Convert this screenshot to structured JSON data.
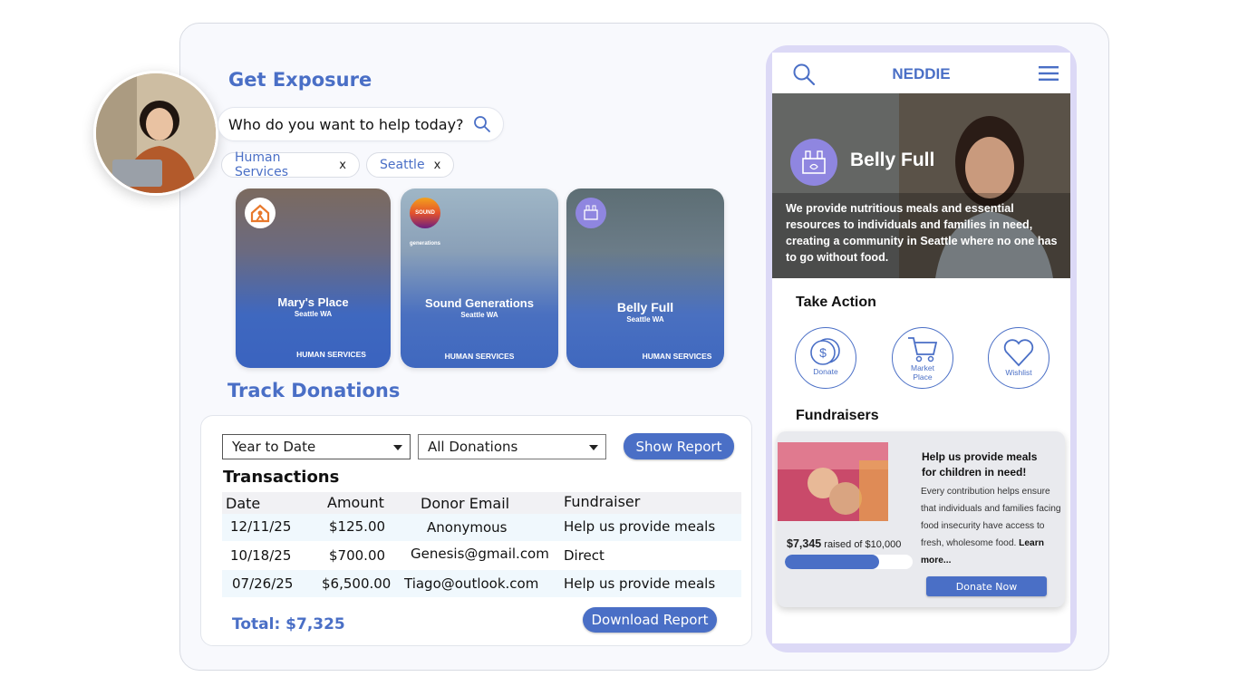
{
  "exposure": {
    "title": "Get Exposure",
    "search_placeholder": "Who do you want to help today?",
    "filters": [
      {
        "label": "Human Services",
        "remove": "x"
      },
      {
        "label": "Seattle",
        "remove": "x"
      }
    ],
    "cards": [
      {
        "name": "Mary's Place",
        "location": "Seattle WA",
        "category": "HUMAN SERVICES"
      },
      {
        "name": "Sound Generations",
        "location": "Seattle WA",
        "category": "HUMAN SERVICES",
        "logo_text": "SOUND generations"
      },
      {
        "name": "Belly Full",
        "location": "Seattle WA",
        "category": "HUMAN SERVICES"
      }
    ]
  },
  "donations": {
    "title": "Track Donations",
    "period": "Year to Date",
    "type": "All Donations",
    "show_report": "Show Report",
    "transactions_title": "Transactions",
    "columns": [
      "Date",
      "Amount",
      "Donor Email",
      "Fundraiser"
    ],
    "rows": [
      {
        "date": "12/11/25",
        "amount": "$125.00",
        "email": "Anonymous",
        "fundraiser": "Help us provide meals"
      },
      {
        "date": "10/18/25",
        "amount": "$700.00",
        "email": "Genesis@gmail.com",
        "fundraiser": "Direct"
      },
      {
        "date": "07/26/25",
        "amount": "$6,500.00",
        "email": "Tiago@outlook.com",
        "fundraiser": "Help us provide meals"
      }
    ],
    "total": "Total: $7,325",
    "download": "Download Report"
  },
  "phone": {
    "app_name": "NEDDIE",
    "org_name": "Belly Full",
    "description": "We provide nutritious meals and essential resources to individuals and families in need, creating a community in Seattle where no one has to go without food.",
    "take_action_title": "Take Action",
    "actions": [
      {
        "label": "Donate",
        "icon": "dollar-coin-icon"
      },
      {
        "label": "Market Place",
        "icon": "shopping-cart-icon"
      },
      {
        "label": "Wishlist",
        "icon": "heart-icon"
      }
    ],
    "fundraisers_title": "Fundraisers",
    "fundraiser": {
      "title": "Help us provide meals for children in need!",
      "body": "Every contribution helps ensure that individuals and families facing food insecurity have access to fresh, wholesome food.",
      "learn_more": "Learn more...",
      "raised_amount": "$7,345",
      "raised_text": "raised of $10,000",
      "progress": 0.7345,
      "donate_label": "Donate Now"
    }
  },
  "colors": {
    "accent": "#4a6fc6",
    "phone_frame": "#dcd9f6",
    "logo_purple": "#8f86e0",
    "marys_orange": "#e8792d"
  }
}
